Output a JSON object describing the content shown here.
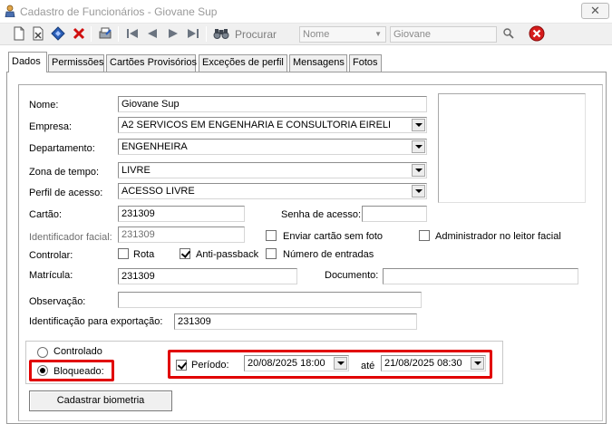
{
  "window": {
    "title": "Cadastro de Funcionários - Giovane Sup",
    "close_glyph": "✕"
  },
  "toolbar": {
    "search_label": "Procurar",
    "field_select": "Nome",
    "search_value": "Giovane"
  },
  "tabs": [
    {
      "label": "Dados"
    },
    {
      "label": "Permissões"
    },
    {
      "label": "Cartões Provisórios"
    },
    {
      "label": "Exceções de perfil"
    },
    {
      "label": "Mensagens"
    },
    {
      "label": "Fotos"
    }
  ],
  "form": {
    "nome": {
      "label": "Nome:",
      "value": "Giovane Sup"
    },
    "empresa": {
      "label": "Empresa:",
      "value": "A2 SERVICOS EM ENGENHARIA E CONSULTORIA EIRELI"
    },
    "departamento": {
      "label": "Departamento:",
      "value": "ENGENHEIRA"
    },
    "zona": {
      "label": "Zona de tempo:",
      "value": "LIVRE"
    },
    "perfil": {
      "label": "Perfil de acesso:",
      "value": "ACESSO LIVRE"
    },
    "cartao": {
      "label": "Cartão:",
      "value": "231309"
    },
    "senha": {
      "label": "Senha de acesso:",
      "value": ""
    },
    "identificador": {
      "label": "Identificador facial:",
      "value": "231309"
    },
    "enviar_cartao": {
      "label": "Enviar cartão sem foto"
    },
    "admin_facial": {
      "label": "Administrador no leitor facial"
    },
    "controlar": {
      "label": "Controlar:"
    },
    "rota": {
      "label": "Rota"
    },
    "antipassback": {
      "label": "Anti-passback"
    },
    "num_entradas": {
      "label": "Número de entradas"
    },
    "matricula": {
      "label": "Matrícula:",
      "value": "231309"
    },
    "documento": {
      "label": "Documento:",
      "value": ""
    },
    "observacao": {
      "label": "Observação:",
      "value": ""
    },
    "exportacao": {
      "label": "Identificação para exportação:",
      "value": "231309"
    }
  },
  "status": {
    "controlado": "Controlado",
    "bloqueado": "Bloqueado:",
    "periodo": "Período:",
    "from": "20/08/2025 18:00",
    "ate": "até",
    "to": "21/08/2025 08:30"
  },
  "buttons": {
    "biometria": "Cadastrar biometria"
  },
  "colors": {
    "highlight": "#e10000",
    "stop_red": "#d61c1c"
  }
}
